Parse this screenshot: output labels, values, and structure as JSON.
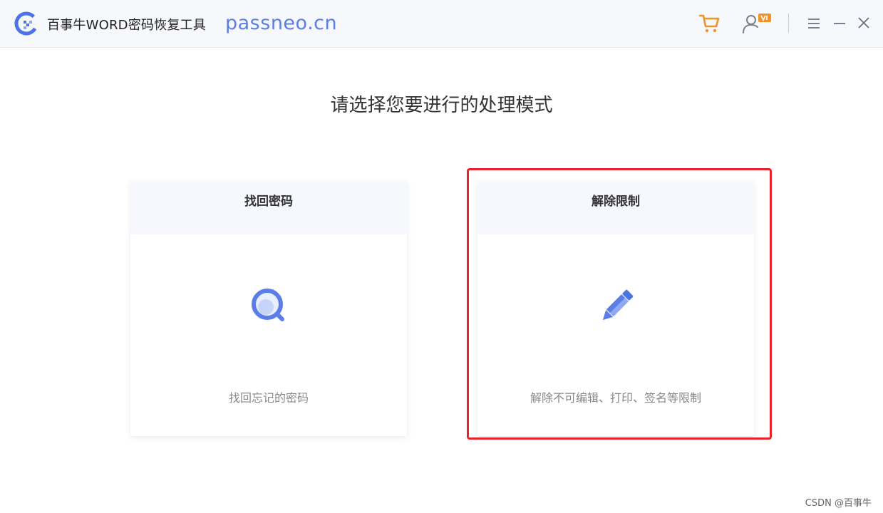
{
  "app": {
    "title": "百事牛WORD密码恢复工具",
    "url_watermark": "passneo.cn"
  },
  "toolbar": {
    "icons": [
      "shopping-cart-icon",
      "user-vip-icon",
      "menu-icon",
      "minimize-icon",
      "close-icon"
    ]
  },
  "main": {
    "prompt": "请选择您要进行的处理模式",
    "cards": [
      {
        "title": "找回密码",
        "description": "找回忘记的密码",
        "icon": "magnifier-icon"
      },
      {
        "title": "解除限制",
        "description": "解除不可编辑、打印、签名等限制",
        "icon": "pencil-icon"
      }
    ]
  },
  "colors": {
    "accent_blue": "#5a7de8",
    "cart_orange": "#f29327",
    "highlight_red": "#e8232b"
  },
  "footer": {
    "watermark": "CSDN @百事牛"
  }
}
